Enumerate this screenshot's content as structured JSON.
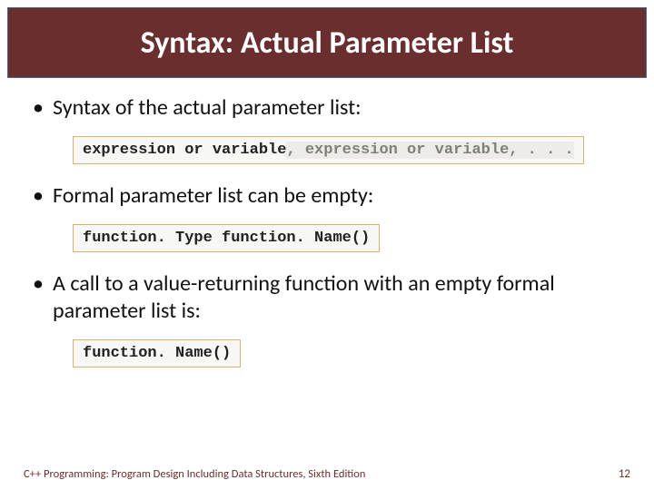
{
  "title": "Syntax: Actual Parameter List",
  "bullets": {
    "b1": "Syntax of the actual parameter list:",
    "b2": "Formal parameter list can be empty:",
    "b3": "A call to a value-returning function with an empty formal parameter list is:"
  },
  "code": {
    "c1_part1": "expression or variable",
    "c1_part2": ", expression or variable, . . .",
    "c2": "function. Type function. Name()",
    "c3": "function. Name()"
  },
  "footer": {
    "left": "C++ Programming: Program Design Including Data Structures, Sixth Edition",
    "page": "12"
  }
}
